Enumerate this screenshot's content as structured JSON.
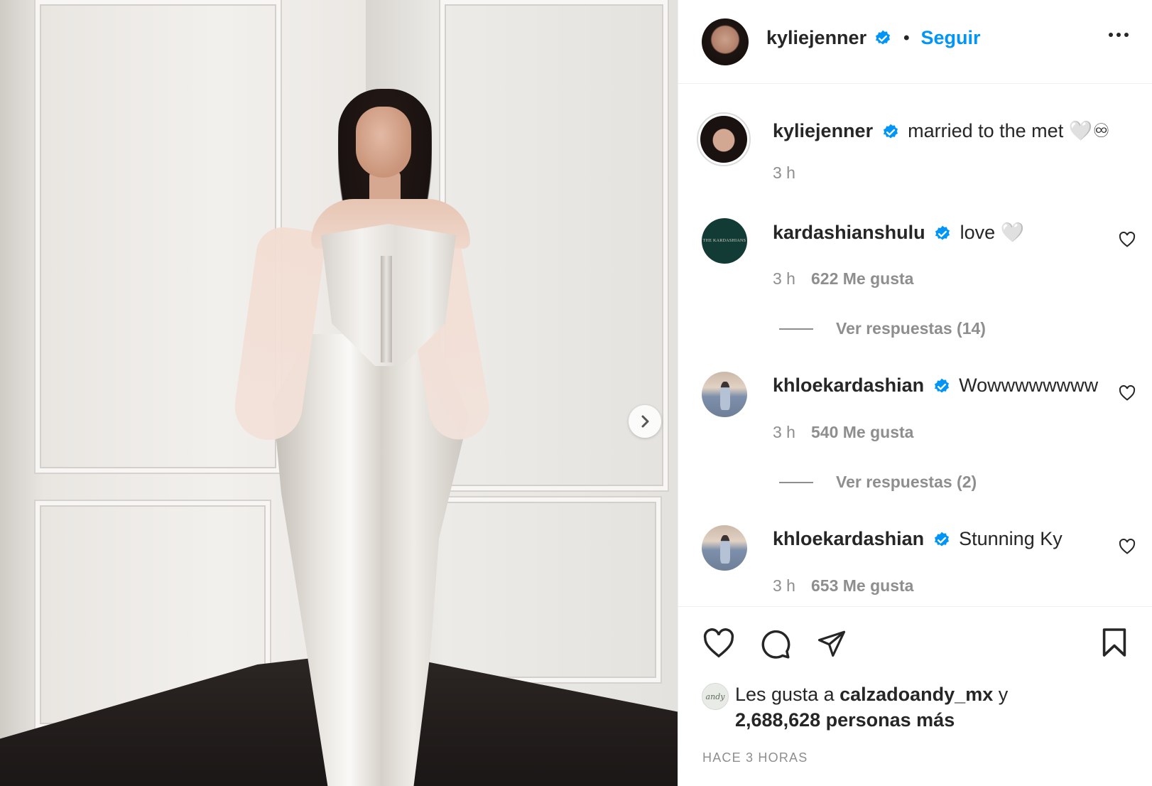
{
  "post": {
    "author": "kyliejenner",
    "follow_label": "Seguir",
    "separator": "•",
    "caption": {
      "username": "kyliejenner",
      "text": "married to the met 🤍♾",
      "time": "3 h"
    }
  },
  "comments": [
    {
      "username": "kardashianshulu",
      "avatar_text": "THE KARDASHIANS",
      "text": "love 🤍",
      "time": "3 h",
      "likes": "622 Me gusta",
      "replies": "Ver respuestas (14)"
    },
    {
      "username": "khloekardashian",
      "text": "Wowwwwwwww",
      "time": "3 h",
      "likes": "540 Me gusta",
      "replies": "Ver respuestas (2)"
    },
    {
      "username": "khloekardashian",
      "text": "Stunning Ky",
      "time": "3 h",
      "likes": "653 Me gusta"
    }
  ],
  "footer": {
    "liked_prefix": "Les gusta a",
    "liked_user": "calzadoandy_mx",
    "liked_conj": "y",
    "liked_others": "2,688,628 personas más",
    "andy_avatar_text": "andy",
    "time_ago": "HACE 3 HORAS"
  },
  "icons": {
    "verified": "verified-badge-icon",
    "more": "more-options-icon",
    "next": "chevron-right-icon",
    "like": "heart-icon",
    "comment": "comment-icon",
    "share": "send-icon",
    "save": "bookmark-icon"
  },
  "colors": {
    "accent": "#0095f6",
    "secondary_text": "#8e8e8e",
    "primary_text": "#262626"
  }
}
